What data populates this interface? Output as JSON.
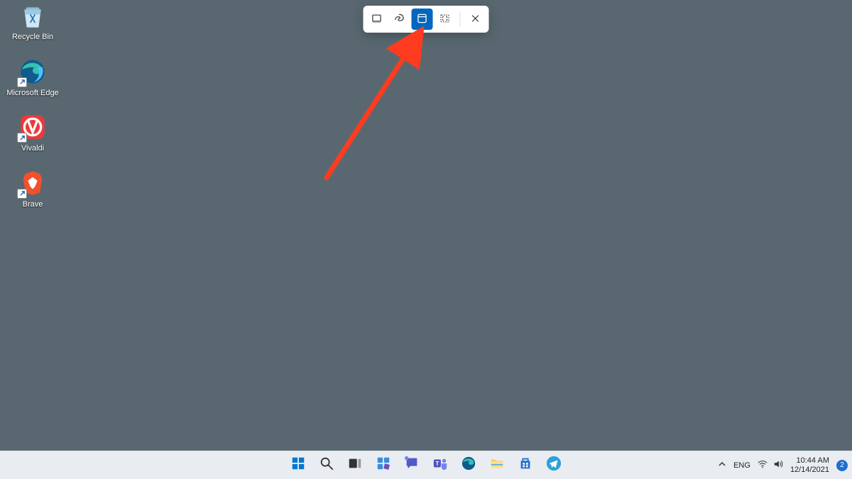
{
  "desktop_icons": [
    {
      "name": "recycle-bin-icon",
      "label": "Recycle Bin",
      "shortcut": false
    },
    {
      "name": "microsoft-edge-icon",
      "label": "Microsoft Edge",
      "shortcut": true
    },
    {
      "name": "vivaldi-icon",
      "label": "Vivaldi",
      "shortcut": true
    },
    {
      "name": "brave-icon",
      "label": "Brave",
      "shortcut": true
    }
  ],
  "snip_toolbar": {
    "modes": [
      {
        "name": "rectangular-snip-icon",
        "selected": false
      },
      {
        "name": "freeform-snip-icon",
        "selected": false
      },
      {
        "name": "window-snip-icon",
        "selected": true
      },
      {
        "name": "fullscreen-snip-icon",
        "selected": false
      }
    ],
    "close": "close-icon"
  },
  "taskbar": {
    "center_items": [
      "start-icon",
      "search-icon",
      "task-view-icon",
      "widgets-icon",
      "chat-icon",
      "teams-icon",
      "edge-icon",
      "file-explorer-icon",
      "microsoft-store-icon",
      "telegram-icon"
    ]
  },
  "tray": {
    "overflow": "chevron-up-icon",
    "language": "ENG",
    "wifi": "wifi-icon",
    "volume": "volume-icon",
    "time": "10:44 AM",
    "date": "12/14/2021",
    "notification_count": "2"
  },
  "annotation": {
    "color": "#ff3b1f"
  }
}
